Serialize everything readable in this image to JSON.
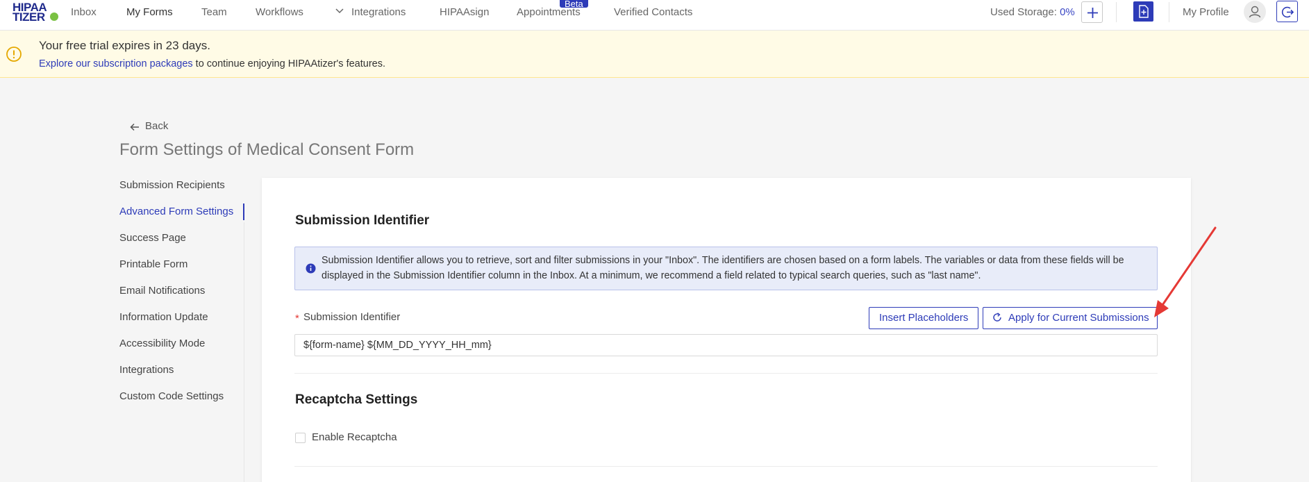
{
  "brand": {
    "line1": "HIPAA",
    "line2": "TIZER"
  },
  "topnav": {
    "items": [
      "Inbox",
      "My Forms",
      "Team",
      "Workflows",
      "Integrations",
      "HIPAAsign",
      "Appointments",
      "Verified Contacts"
    ],
    "beta_badge": "Beta",
    "storage_label": "Used Storage: ",
    "storage_value": "0%",
    "profile_label": "My Profile"
  },
  "banner": {
    "title": "Your free trial expires in 23 days.",
    "link": "Explore our subscription packages",
    "rest": " to continue enjoying HIPAAtizer's features."
  },
  "header": {
    "back_label": "Back",
    "title": "Form Settings of Medical Consent Form"
  },
  "settings_nav": {
    "items": [
      "Submission Recipients",
      "Advanced Form Settings",
      "Success Page",
      "Printable Form",
      "Email Notifications",
      "Information Update",
      "Accessibility Mode",
      "Integrations",
      "Custom Code Settings"
    ],
    "active_index": 1
  },
  "submission_identifier": {
    "section_title": "Submission Identifier",
    "info": "Submission Identifier allows you to retrieve, sort and filter submissions in your \"Inbox\". The identifiers are chosen based on a form labels. The variables or data from these fields will be displayed in the Submission Identifier column in the Inbox. At a minimum, we recommend a field related to typical search queries, such as \"last name\".",
    "required_mark": "*",
    "field_label": "Submission Identifier",
    "insert_button": "Insert Placeholders",
    "apply_button": "Apply for Current Submissions",
    "value": "${form-name} ${MM_DD_YYYY_HH_mm}"
  },
  "recaptcha": {
    "section_title": "Recaptcha Settings",
    "checkbox_label": "Enable Recaptcha",
    "checked": false
  },
  "colors": {
    "accent": "#2d3bb8",
    "banner_bg": "#fffbe6",
    "arrow": "#e53935"
  }
}
